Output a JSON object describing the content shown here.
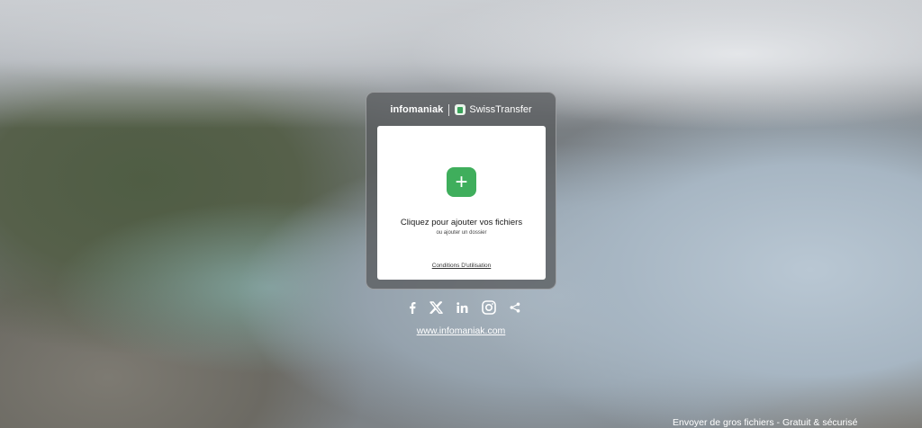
{
  "header": {
    "brand": "infomaniak",
    "product": "SwissTransfer"
  },
  "upload": {
    "add_icon": "plus-icon",
    "prompt": "Cliquez pour ajouter vos fichiers",
    "folder_option": "ou ajouter un dossier",
    "terms_link": "Conditions D'utilisation"
  },
  "social": {
    "icons": [
      "facebook-icon",
      "x-icon",
      "linkedin-icon",
      "instagram-icon",
      "share-icon"
    ]
  },
  "footer": {
    "website": "www.infomaniak.com",
    "tagline": "Envoyer de gros fichiers - Gratuit & sécurisé"
  },
  "colors": {
    "accent": "#3fae5c",
    "card_bg": "#5a5c5f"
  }
}
